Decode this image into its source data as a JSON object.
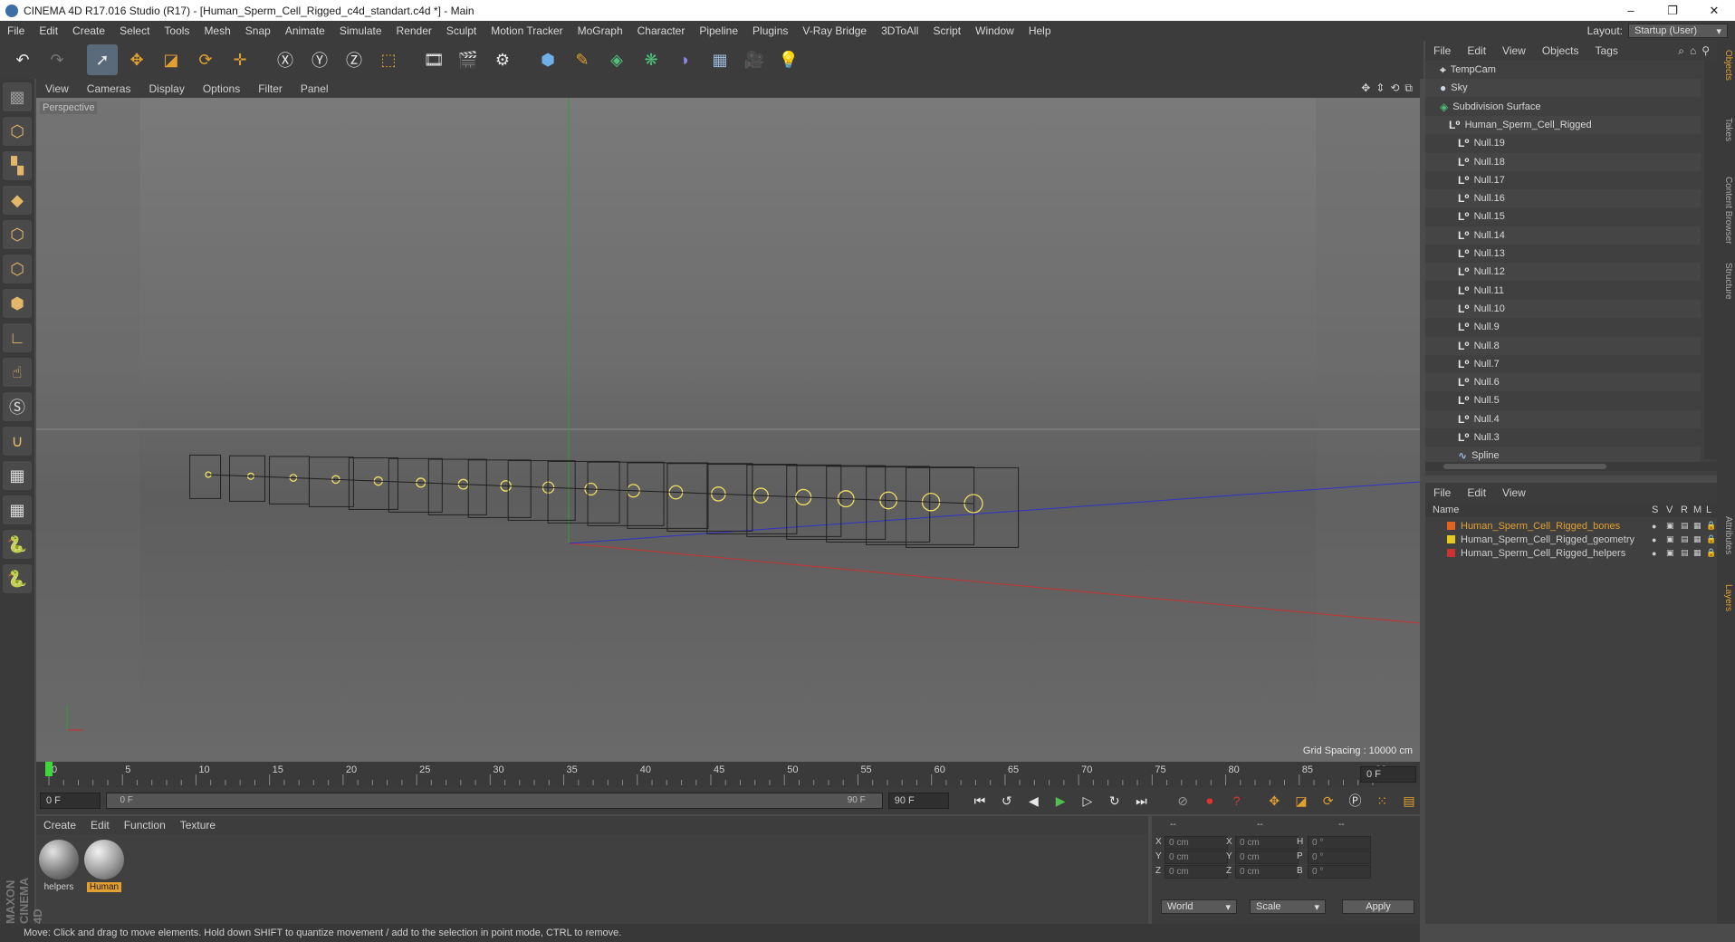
{
  "window": {
    "title": "CINEMA 4D R17.016 Studio (R17) - [Human_Sperm_Cell_Rigged_c4d_standart.c4d *] - Main",
    "controls": [
      "–",
      "❐",
      "✕"
    ]
  },
  "menubar": {
    "items": [
      "File",
      "Edit",
      "Create",
      "Select",
      "Tools",
      "Mesh",
      "Snap",
      "Animate",
      "Simulate",
      "Render",
      "Sculpt",
      "Motion Tracker",
      "MoGraph",
      "Character",
      "Pipeline",
      "Plugins",
      "V-Ray Bridge",
      "3DToAll",
      "Script",
      "Window",
      "Help"
    ],
    "layout_label": "Layout:",
    "layout_value": "Startup (User)"
  },
  "toolbar": {
    "icons": [
      "undo-icon",
      "redo-icon",
      "select-icon",
      "move-icon",
      "scale-icon",
      "rotate-icon",
      "transform-icon",
      "x-axis-icon",
      "y-axis-icon",
      "z-axis-icon",
      "coordinate-system-icon",
      "render-view-icon",
      "render-picture-icon",
      "render-settings-icon",
      "cube-icon",
      "pen-icon",
      "subdivision-icon",
      "cloner-icon",
      "deformer-icon",
      "floor-icon",
      "camera-icon",
      "light-icon"
    ]
  },
  "viewport": {
    "menu": [
      "View",
      "Cameras",
      "Display",
      "Options",
      "Filter",
      "Panel"
    ],
    "label": "Perspective",
    "grid_spacing": "Grid Spacing : 10000 cm"
  },
  "timeline": {
    "ticks": [
      "0",
      "5",
      "10",
      "15",
      "20",
      "25",
      "30",
      "35",
      "40",
      "45",
      "50",
      "55",
      "60",
      "65",
      "70",
      "75",
      "80",
      "85",
      "90"
    ],
    "current_frame": "0 F",
    "start_field": "0 F",
    "range_start": "0 F",
    "range_end": "90 F",
    "end_field": "90 F"
  },
  "material_manager": {
    "menu": [
      "Create",
      "Edit",
      "Function",
      "Texture"
    ],
    "materials": [
      {
        "name": "helpers",
        "selected": false
      },
      {
        "name": "Human",
        "selected": true
      }
    ]
  },
  "coordinates": {
    "headers": [
      "--",
      "--",
      "--"
    ],
    "rows": [
      {
        "a": "X",
        "av": "0 cm",
        "b": "X",
        "bv": "0 cm",
        "c": "H",
        "cv": "0 °"
      },
      {
        "a": "Y",
        "av": "0 cm",
        "b": "Y",
        "bv": "0 cm",
        "c": "P",
        "cv": "0 °"
      },
      {
        "a": "Z",
        "av": "0 cm",
        "b": "Z",
        "bv": "0 cm",
        "c": "B",
        "cv": "0 °"
      }
    ],
    "space": "World",
    "mode": "Scale",
    "apply": "Apply"
  },
  "status": "Move: Click and drag to move elements. Hold down SHIFT to quantize movement / add to the selection in point mode, CTRL to remove.",
  "object_manager": {
    "menu": [
      "File",
      "Edit",
      "View",
      "Objects",
      "Tags"
    ],
    "objects": [
      {
        "name": "TempCam",
        "indent": 1,
        "icon": "camera"
      },
      {
        "name": "Sky",
        "indent": 1,
        "icon": "sky"
      },
      {
        "name": "Subdivision Surface",
        "indent": 1,
        "icon": "subdiv"
      },
      {
        "name": "Human_Sperm_Cell_Rigged",
        "indent": 2,
        "icon": "null"
      },
      {
        "name": "Null.19",
        "indent": 3,
        "icon": "null"
      },
      {
        "name": "Null.18",
        "indent": 3,
        "icon": "null"
      },
      {
        "name": "Null.17",
        "indent": 3,
        "icon": "null"
      },
      {
        "name": "Null.16",
        "indent": 3,
        "icon": "null"
      },
      {
        "name": "Null.15",
        "indent": 3,
        "icon": "null"
      },
      {
        "name": "Null.14",
        "indent": 3,
        "icon": "null"
      },
      {
        "name": "Null.13",
        "indent": 3,
        "icon": "null"
      },
      {
        "name": "Null.12",
        "indent": 3,
        "icon": "null"
      },
      {
        "name": "Null.11",
        "indent": 3,
        "icon": "null"
      },
      {
        "name": "Null.10",
        "indent": 3,
        "icon": "null"
      },
      {
        "name": "Null.9",
        "indent": 3,
        "icon": "null"
      },
      {
        "name": "Null.8",
        "indent": 3,
        "icon": "null"
      },
      {
        "name": "Null.7",
        "indent": 3,
        "icon": "null"
      },
      {
        "name": "Null.6",
        "indent": 3,
        "icon": "null"
      },
      {
        "name": "Null.5",
        "indent": 3,
        "icon": "null"
      },
      {
        "name": "Null.4",
        "indent": 3,
        "icon": "null"
      },
      {
        "name": "Null.3",
        "indent": 3,
        "icon": "null"
      },
      {
        "name": "Spline",
        "indent": 3,
        "icon": "spline"
      }
    ]
  },
  "layer_manager": {
    "menu": [
      "File",
      "Edit",
      "View"
    ],
    "columns": [
      "Name",
      "S",
      "V",
      "R",
      "M",
      "L"
    ],
    "layers": [
      {
        "name": "Human_Sperm_Cell_Rigged_bones",
        "color": "#e0641e",
        "highlight": true
      },
      {
        "name": "Human_Sperm_Cell_Rigged_geometry",
        "color": "#e4c81e",
        "highlight": false
      },
      {
        "name": "Human_Sperm_Cell_Rigged_helpers",
        "color": "#c83232",
        "highlight": false
      }
    ]
  },
  "right_tabs": [
    "Objects",
    "Takes",
    "Content Browser",
    "Structure",
    "Attributes",
    "Layers"
  ],
  "colors": {
    "accent": "#e2a030",
    "x_axis": "#c83232",
    "y_axis": "#2fa02f",
    "z_axis": "#3232c8"
  }
}
